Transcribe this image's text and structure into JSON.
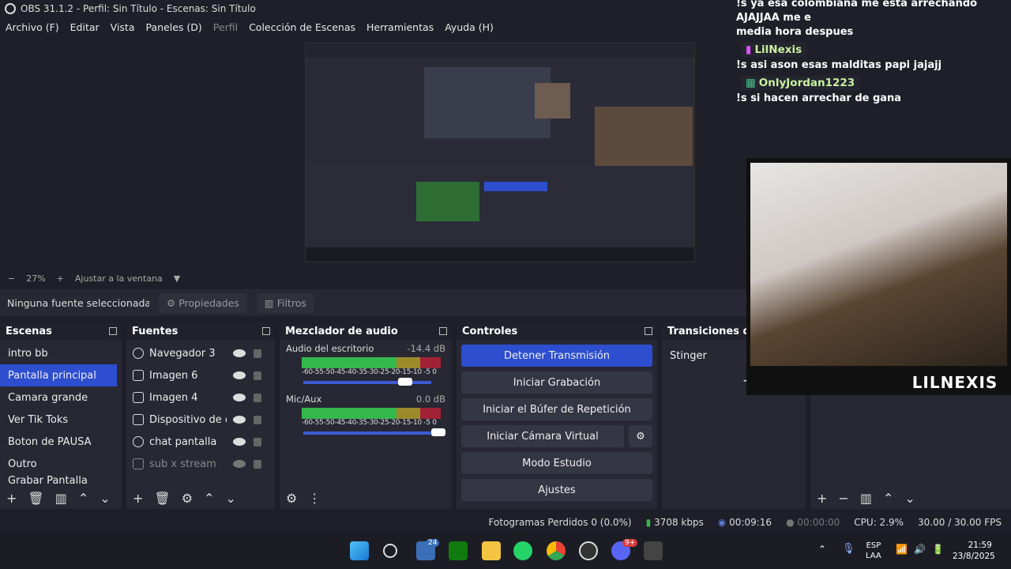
{
  "window_title": "OBS 31.1.2 - Perfil: Sin Título - Escenas: Sin Título",
  "menu": [
    "Archivo (F)",
    "Editar",
    "Vista",
    "Paneles (D)",
    "Perfil",
    "Colección de Escenas",
    "Herramientas",
    "Ayuda (H)"
  ],
  "zoom": {
    "minus": "−",
    "value": "27%",
    "plus": "+",
    "fit": "Ajustar a la ventana"
  },
  "sourcebar": {
    "none_selected": "Ninguna fuente seleccionada",
    "properties": "Propiedades",
    "filters": "Filtros"
  },
  "scenes": {
    "title": "Escenas",
    "items": [
      "intro bb",
      "Pantalla principal",
      "Camara grande",
      "Ver Tik Toks",
      "Boton de PAUSA",
      "Outro",
      "Grabar Pantalla"
    ]
  },
  "sources": {
    "title": "Fuentes",
    "items": [
      "Navegador 3",
      "Imagen 6",
      "Imagen 4",
      "Dispositivo de ca",
      "chat pantalla",
      "sub x stream"
    ]
  },
  "mixer": {
    "title": "Mezclador de audio",
    "channels": [
      {
        "name": "Audio del escritorio",
        "db": "-14.4 dB",
        "level": 0.78
      },
      {
        "name": "Mic/Aux",
        "db": "0.0 dB",
        "level": 1.0
      }
    ],
    "scale": "-60-55-50-45-40-35-30-25-20-15-10 -5  0"
  },
  "controls": {
    "title": "Controles",
    "buttons": [
      "Detener Transmisión",
      "Iniciar Grabación",
      "Iniciar el Búfer de Repetición",
      "Iniciar Cámara Virtual",
      "Modo Estudio",
      "Ajustes"
    ]
  },
  "transitions": {
    "title": "Transiciones de e",
    "value": "Stinger"
  },
  "status": {
    "dropped": "Fotogramas Perdidos 0 (0.0%)",
    "bitrate": "3708 kbps",
    "stream_time": "00:09:16",
    "rec_time": "00:00:00",
    "cpu": "CPU: 2.9%",
    "fps": "30.00 / 30.00 FPS"
  },
  "chat": {
    "lines": [
      {
        "user": "",
        "text": "!s ya esa colombiana me esta arrechando AJAJJAA me e"
      },
      {
        "user": "",
        "text": "media hora despues"
      },
      {
        "user": "LilNexis",
        "text": "!s asi ason esas malditas papi jajajj"
      },
      {
        "user": "OnlyJordan1223",
        "text": "!s si hacen arrechar de gana"
      }
    ]
  },
  "webcam_label": "LILNEXIS",
  "taskbar": {
    "lang": "ESP",
    "layout": "LAA",
    "time": "21:59",
    "date": "23/8/2025",
    "badge_widgets": "24",
    "badge_discord": "9+"
  }
}
